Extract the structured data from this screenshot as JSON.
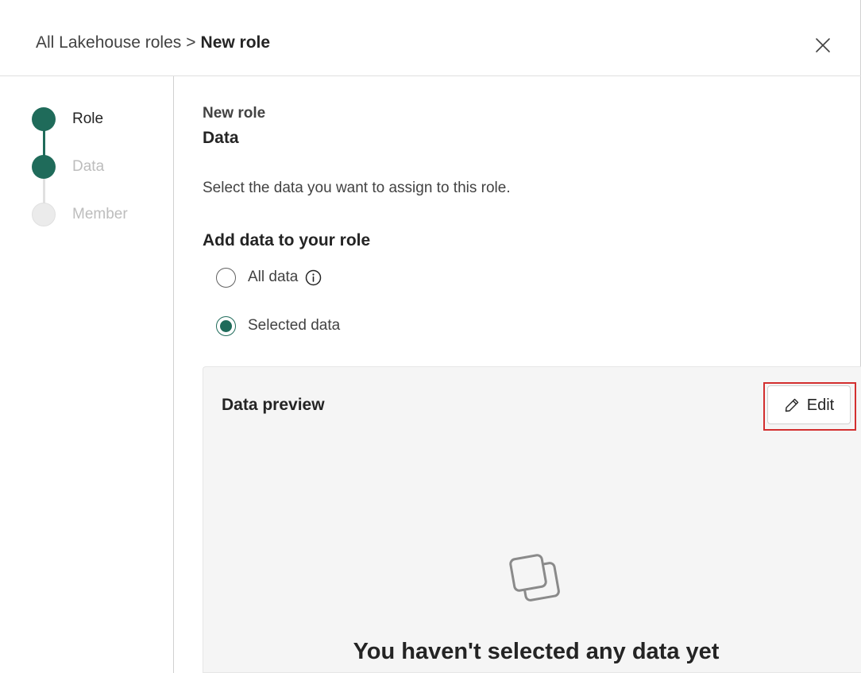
{
  "header": {
    "breadcrumb_parent": "All Lakehouse roles",
    "breadcrumb_separator": ">",
    "breadcrumb_current": "New role",
    "close_icon": "close-icon"
  },
  "stepper": {
    "steps": [
      {
        "label": "Role",
        "state": "complete"
      },
      {
        "label": "Data",
        "state": "current"
      },
      {
        "label": "Member",
        "state": "pending"
      }
    ]
  },
  "main": {
    "subtitle": "New role",
    "title": "Data",
    "description": "Select the data you want to assign to this role.",
    "section_heading": "Add data to your role",
    "options": [
      {
        "label": "All data",
        "checked": false,
        "icon": "info-icon"
      },
      {
        "label": "Selected data",
        "checked": true
      }
    ]
  },
  "preview": {
    "title": "Data preview",
    "edit_label": "Edit",
    "edit_icon": "pencil-icon",
    "empty_icon": "stacked-squares-icon",
    "empty_message": "You haven't selected any data yet"
  },
  "colors": {
    "accent": "#1f6b5a",
    "highlight": "#d32f2f",
    "panel_bg": "#f5f5f5"
  }
}
